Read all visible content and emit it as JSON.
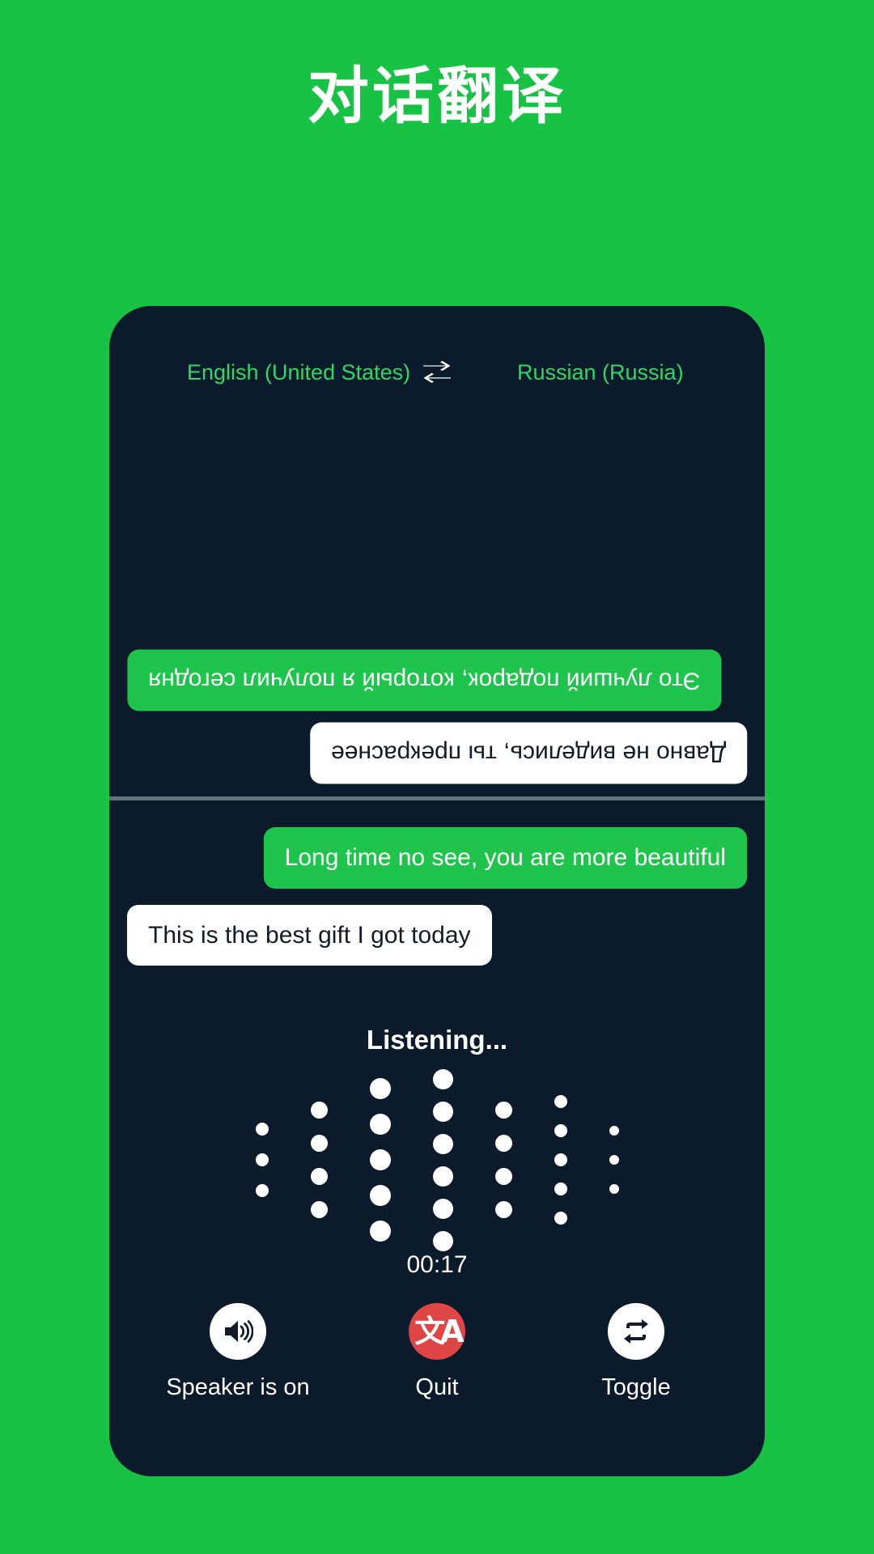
{
  "page": {
    "title": "对话翻译",
    "background_color": "#17c244"
  },
  "header": {
    "source_language": "English (United States)",
    "target_language": "Russian (Russia)",
    "swap_icon": "swap-horizontal-icon"
  },
  "conversation": {
    "top_pane_rotated": true,
    "top_messages": [
      {
        "text": "Это лучший подарок, который я получил сегодня",
        "style": "green",
        "align": "left",
        "language": "Russian"
      },
      {
        "text": "Давно не виделись, ты прекраснее",
        "style": "white",
        "align": "right",
        "language": "Russian"
      }
    ],
    "bottom_messages": [
      {
        "text": "Long time no see, you are more beautiful",
        "style": "green",
        "align": "right",
        "language": "English"
      },
      {
        "text": "This is the best gift I got today",
        "style": "white",
        "align": "left",
        "language": "English"
      }
    ]
  },
  "status": {
    "listening_label": "Listening...",
    "timer": "00:17"
  },
  "waveform": {
    "columns": [
      {
        "dot_size": 16,
        "count": 3,
        "gap": 22
      },
      {
        "dot_size": 21,
        "count": 4,
        "gap": 20
      },
      {
        "dot_size": 26,
        "count": 5,
        "gap": 18
      },
      {
        "dot_size": 25,
        "count": 6,
        "gap": 15
      },
      {
        "dot_size": 21,
        "count": 4,
        "gap": 20
      },
      {
        "dot_size": 16,
        "count": 5,
        "gap": 20
      },
      {
        "dot_size": 12,
        "count": 3,
        "gap": 24
      }
    ],
    "color": "#ffffff"
  },
  "controls": [
    {
      "label": "Speaker is on",
      "icon": "speaker-on-icon",
      "circle_color": "#ffffff",
      "icon_color": "#131c26"
    },
    {
      "label": "Quit",
      "icon": "translate-icon",
      "circle_color": "#e04545",
      "icon_color": "#ffffff"
    },
    {
      "label": "Toggle",
      "icon": "repeat-arrows-icon",
      "circle_color": "#ffffff",
      "icon_color": "#131c26"
    }
  ],
  "colors": {
    "accent_green": "#17c244",
    "bubble_green": "#1ec44b",
    "card_dark": "#0b1b2b",
    "lang_green": "#2fd864",
    "divider": "#64707d",
    "quit_red": "#e04545"
  }
}
